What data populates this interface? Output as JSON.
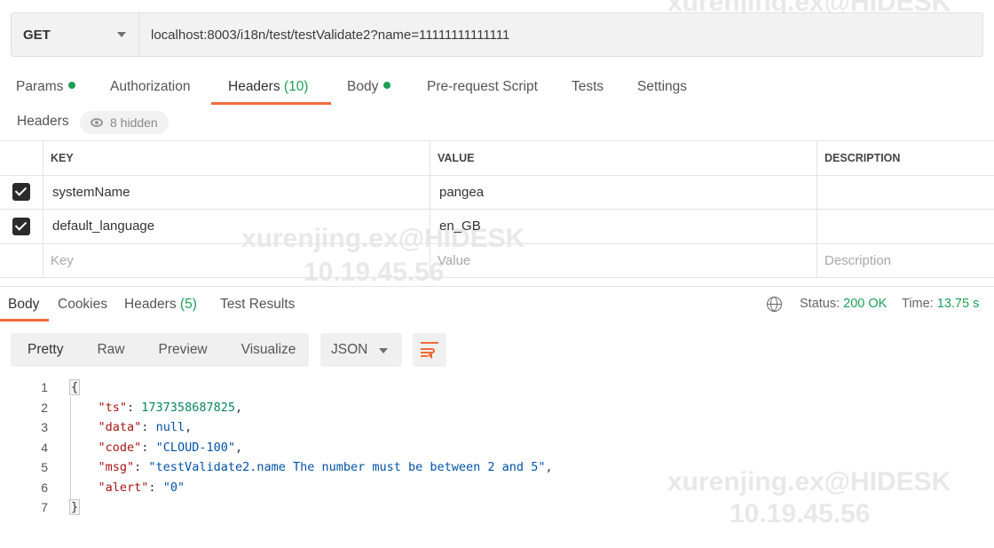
{
  "request": {
    "method": "GET",
    "url": "localhost:8003/i18n/test/testValidate2?name=11111111111111"
  },
  "request_tabs": [
    {
      "label": "Params",
      "dot": true
    },
    {
      "label": "Authorization"
    },
    {
      "label": "Headers",
      "count": "(10)",
      "active": true
    },
    {
      "label": "Body",
      "dot": true
    },
    {
      "label": "Pre-request Script"
    },
    {
      "label": "Tests"
    },
    {
      "label": "Settings"
    }
  ],
  "headers_section": {
    "label": "Headers",
    "hidden_label": "8 hidden"
  },
  "headers_table": {
    "columns": {
      "key": "KEY",
      "value": "VALUE",
      "description": "DESCRIPTION"
    },
    "rows": [
      {
        "checked": true,
        "key": "systemName",
        "value": "pangea",
        "description": ""
      },
      {
        "checked": true,
        "key": "default_language",
        "value": "en_GB",
        "description": ""
      }
    ],
    "placeholder": {
      "key": "Key",
      "value": "Value",
      "description": "Description"
    }
  },
  "response_tabs": [
    {
      "label": "Body",
      "active": true
    },
    {
      "label": "Cookies"
    },
    {
      "label": "Headers",
      "count": "(5)"
    },
    {
      "label": "Test Results"
    }
  ],
  "response_status": {
    "status_label": "Status:",
    "status_value": "200 OK",
    "time_label": "Time:",
    "time_value": "13.75 s"
  },
  "response_view": {
    "modes": [
      "Pretty",
      "Raw",
      "Preview",
      "Visualize"
    ],
    "active_mode": "Pretty",
    "format": "JSON"
  },
  "response_body": {
    "line_numbers": [
      "1",
      "2",
      "3",
      "4",
      "5",
      "6",
      "7"
    ],
    "open": "{",
    "close": "}",
    "fields": [
      {
        "key": "\"ts\"",
        "value": "1737358687825",
        "kind": "n",
        "comma": ","
      },
      {
        "key": "\"data\"",
        "value": "null",
        "kind": "nl",
        "comma": ","
      },
      {
        "key": "\"code\"",
        "value": "\"CLOUD-100\"",
        "kind": "s",
        "comma": ","
      },
      {
        "key": "\"msg\"",
        "value": "\"testValidate2.name The number must be between 2 and 5\"",
        "kind": "s",
        "comma": ","
      },
      {
        "key": "\"alert\"",
        "value": "\"0\"",
        "kind": "s",
        "comma": ""
      }
    ]
  },
  "watermark": {
    "user": "xurenjing.ex@HIDESK",
    "ip": "10.19.45.56"
  },
  "colors": {
    "accent": "#f26b3a",
    "green": "#1e9e55"
  }
}
